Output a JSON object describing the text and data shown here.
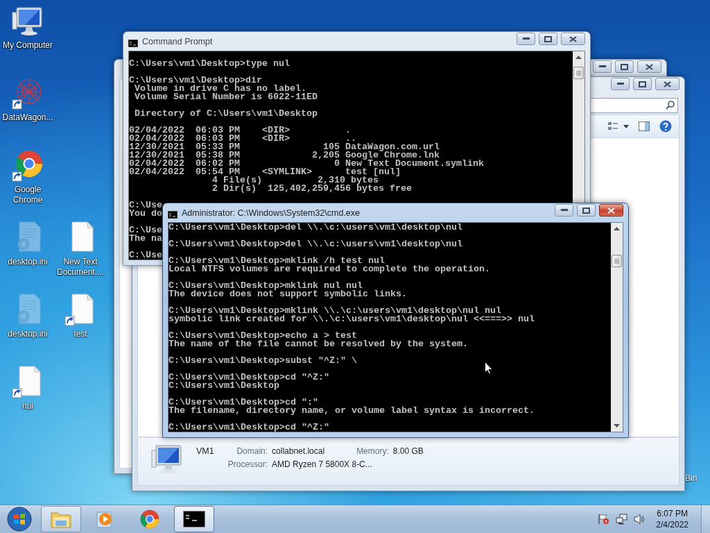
{
  "desktop": {
    "icons": [
      [
        {
          "kind": "computer",
          "label": "My Computer",
          "shortcut": false,
          "hidden": false
        }
      ],
      [
        {
          "kind": "web",
          "label": "DataWagon...",
          "shortcut": true,
          "hidden": false
        }
      ],
      [
        {
          "kind": "chrome",
          "label": "Google Chrome",
          "shortcut": true,
          "hidden": false
        }
      ],
      [
        {
          "kind": "settings-file",
          "label": "desktop.ini",
          "shortcut": false,
          "hidden": true
        },
        {
          "kind": "file",
          "label": "New Text Document....",
          "shortcut": false,
          "hidden": false
        }
      ],
      [
        {
          "kind": "settings-file",
          "label": "desktop.ini",
          "shortcut": false,
          "hidden": true
        },
        {
          "kind": "file",
          "label": "test",
          "shortcut": true,
          "hidden": false
        }
      ],
      [
        {
          "kind": "file",
          "label": "nul",
          "shortcut": true,
          "hidden": false
        }
      ]
    ],
    "partial_label": "Bin"
  },
  "windows": [
    {
      "kind": "console",
      "title": "Administrator: C:\\Windows\\System32\\cmd.exe",
      "active": true,
      "blocks": [
        [
          "C:\\Users\\vm1\\Desktop>del \\\\.\\c:\\users\\vm1\\desktop\\nul"
        ],
        [
          "C:\\Users\\vm1\\Desktop>del \\\\.\\c:\\users\\vm1\\desktop\\nul"
        ],
        [
          "C:\\Users\\vm1\\Desktop>mklink /h test nul",
          "Local NTFS volumes are required to complete the operation."
        ],
        [
          "C:\\Users\\vm1\\Desktop>mklink nul nul",
          "The device does not support symbolic links."
        ],
        [
          "C:\\Users\\vm1\\Desktop>mklink \\\\.\\c:\\users\\vm1\\desktop\\nul nul",
          "symbolic link created for \\\\.\\c:\\users\\vm1\\desktop\\nul <<===>> nul"
        ],
        [
          "C:\\Users\\vm1\\Desktop>echo a > test",
          "The name of the file cannot be resolved by the system."
        ],
        [
          "C:\\Users\\vm1\\Desktop>subst \"^Z:\" \\"
        ],
        [
          "C:\\Users\\vm1\\Desktop>cd \"^Z:\"",
          "C:\\Users\\vm1\\Desktop"
        ],
        [
          "C:\\Users\\vm1\\Desktop>cd \":\"",
          "The filename, directory name, or volume label syntax is incorrect."
        ],
        [
          "C:\\Users\\vm1\\Desktop>cd \"^Z:\""
        ]
      ]
    },
    {
      "kind": "console",
      "title": "Command Prompt",
      "active": false,
      "blocks": [
        [
          "C:\\Users\\vm1\\Desktop>type nul"
        ],
        [
          "C:\\Users\\vm1\\Desktop>dir",
          " Volume in drive C has no label.",
          " Volume Serial Number is 6022-11ED"
        ],
        [
          " Directory of C:\\Users\\vm1\\Desktop"
        ],
        [
          "02/04/2022  06:03 PM    <DIR>          .",
          "02/04/2022  06:03 PM    <DIR>          ..",
          "12/30/2021  05:33 PM               105 DataWagon.com.url",
          "12/30/2021  05:38 PM             2,205 Google Chrome.lnk",
          "02/04/2022  06:02 PM                 0 New Text Document.symlink",
          "02/04/2022  05:54 PM    <SYMLINK>      test [nul]",
          "               4 File(s)          2,310 bytes",
          "               2 Dir(s)  125,402,259,456 bytes free"
        ],
        [
          "C:\\Use",
          "You do"
        ],
        [
          "C:\\Use",
          "The na"
        ],
        [
          "C:\\Use"
        ]
      ]
    },
    {
      "kind": "explorer",
      "active": false,
      "details": {
        "name": "VM1",
        "fields": [
          {
            "label": "Domain:",
            "value": "collabnet.local"
          },
          {
            "label": "Memory:",
            "value": "8.00 GB"
          },
          {
            "label": "Processor:",
            "value": "AMD Ryzen 7 5800X 8-C..."
          }
        ]
      }
    },
    {
      "kind": "explorer",
      "active": false
    }
  ],
  "taskbar": {
    "items": [
      {
        "kind": "explorer",
        "running": true,
        "selected": false
      },
      {
        "kind": "media",
        "running": false,
        "selected": false
      },
      {
        "kind": "chrome",
        "running": false,
        "selected": false
      },
      {
        "kind": "console",
        "running": true,
        "selected": true
      }
    ],
    "time": "6:07 PM",
    "date": "2/4/2022"
  }
}
